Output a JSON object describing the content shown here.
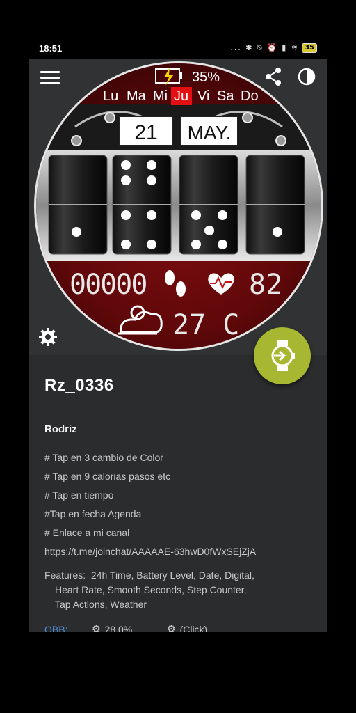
{
  "status_bar": {
    "time": "18:51",
    "icons": "... ✱ ⍉ ⏰ ▮ ≋",
    "battery": "35"
  },
  "watch": {
    "battery_pct": "35%",
    "days": [
      "Lu",
      "Ma",
      "Mi",
      "Ju",
      "Vi",
      "Sa",
      "Do"
    ],
    "active_day_index": 3,
    "date_day": "21",
    "date_month": "MAY.",
    "steps": "00000",
    "heart_rate": "82",
    "temperature": "27 C"
  },
  "details": {
    "title": "Rz_0336",
    "author": "Rodriz",
    "description_lines": [
      "# Tap en 3 cambio de Color",
      "# Tap en 9 calorias pasos etc",
      "# Tap en tiempo",
      "#Tap en fecha Agenda",
      "# Enlace a mi canal",
      "https://t.me/joinchat/AAAAAE-63hwD0fWxSEjZjA"
    ],
    "features_label": "Features:",
    "features_line1": "24h Time,  Battery Level,  Date,  Digital,",
    "features_line2": "Heart Rate,  Smooth Seconds,  Step Counter,",
    "features_line3": "Tap Actions,  Weather",
    "obb_label": "OBB:",
    "obb_value": "28.0%",
    "click_label": "(Click)"
  },
  "colors": {
    "accent": "#a8b732",
    "app_bg": "#2a2c2d",
    "watch_red": "#7d0b0d",
    "link": "#4c8edb"
  }
}
